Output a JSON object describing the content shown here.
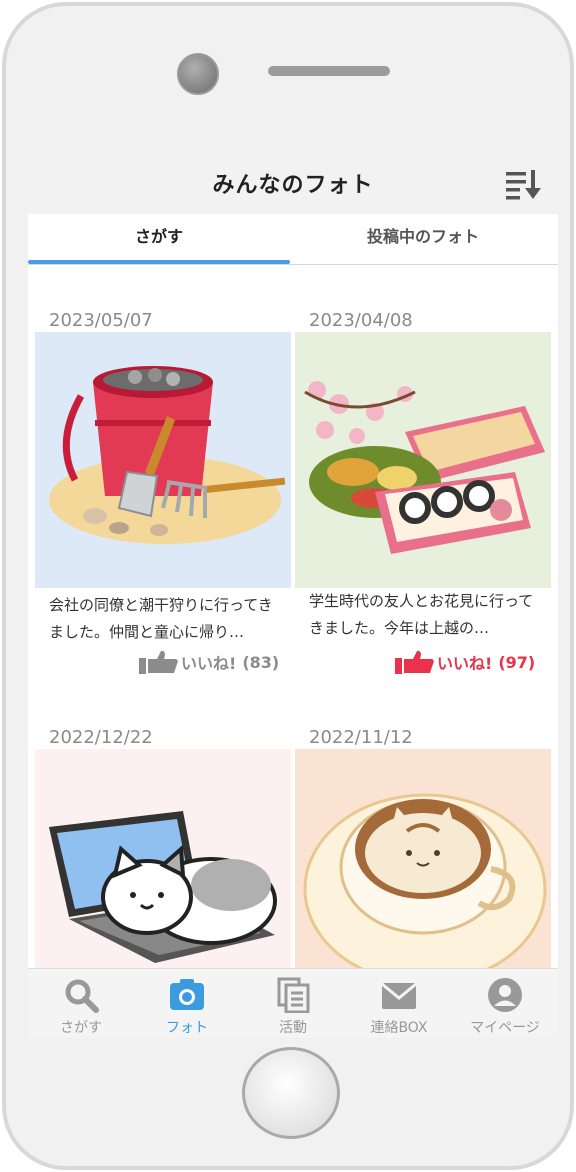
{
  "header": {
    "title": "みんなのフォト",
    "sort_icon": "sort-descending-icon"
  },
  "tabs": [
    {
      "label": "さがす",
      "active": true
    },
    {
      "label": "投稿中のフォト",
      "active": false
    }
  ],
  "posts": [
    {
      "date": "2023/05/07",
      "image": "clam-digging-bucket-illustration",
      "caption": "会社の同僚と潮干狩りに行ってきました。仲間と童心に帰り…",
      "like_label": "いいね!",
      "like_count": "(83)",
      "liked": false
    },
    {
      "date": "2023/04/08",
      "image": "hanami-bento-cherry-blossom-illustration",
      "caption": "学生時代の友人とお花見に行ってきました。今年は上越の…",
      "like_label": "いいね!",
      "like_count": "(97)",
      "liked": true
    },
    {
      "date": "2022/12/22",
      "image": "cat-on-laptop-illustration",
      "caption": "",
      "like_label": "",
      "like_count": "",
      "liked": false
    },
    {
      "date": "2022/11/12",
      "image": "cat-latte-art-illustration",
      "caption": "",
      "like_label": "",
      "like_count": "",
      "liked": false
    }
  ],
  "nav": [
    {
      "label": "さがす",
      "icon": "search-icon",
      "active": false
    },
    {
      "label": "フォト",
      "icon": "camera-icon",
      "active": true
    },
    {
      "label": "活動",
      "icon": "documents-icon",
      "active": false
    },
    {
      "label": "連絡BOX",
      "icon": "mail-icon",
      "active": false
    },
    {
      "label": "マイページ",
      "icon": "user-icon",
      "active": false
    }
  ],
  "colors": {
    "accent": "#4a9be8",
    "liked": "#e8334a",
    "unliked": "#8c8c8c"
  }
}
